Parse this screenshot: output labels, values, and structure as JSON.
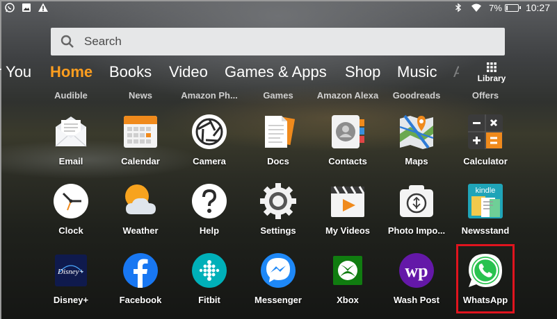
{
  "status_bar": {
    "battery": "7%",
    "time": "10:27",
    "left_icons": [
      "whatsapp-notification-icon",
      "image-notification-icon",
      "warning-icon"
    ],
    "right_icons": [
      "bluetooth-icon",
      "wifi-icon",
      "battery-charging-icon"
    ]
  },
  "search": {
    "placeholder": "Search"
  },
  "tabs": [
    {
      "label": "r You",
      "state": "partial"
    },
    {
      "label": "Home",
      "state": "active"
    },
    {
      "label": "Books",
      "state": "normal"
    },
    {
      "label": "Video",
      "state": "normal"
    },
    {
      "label": "Games & Apps",
      "state": "normal"
    },
    {
      "label": "Shop",
      "state": "normal"
    },
    {
      "label": "Music",
      "state": "normal"
    },
    {
      "label": "Aud",
      "state": "faded"
    }
  ],
  "library": {
    "label": "Library"
  },
  "cut_row": [
    "Audible",
    "News",
    "Amazon Ph...",
    "Games",
    "Amazon Alexa",
    "Goodreads",
    "Offers"
  ],
  "apps": [
    {
      "label": "Email",
      "icon": "email-icon"
    },
    {
      "label": "Calendar",
      "icon": "calendar-icon"
    },
    {
      "label": "Camera",
      "icon": "camera-icon"
    },
    {
      "label": "Docs",
      "icon": "docs-icon"
    },
    {
      "label": "Contacts",
      "icon": "contacts-icon"
    },
    {
      "label": "Maps",
      "icon": "maps-icon"
    },
    {
      "label": "Calculator",
      "icon": "calculator-icon"
    },
    {
      "label": "Clock",
      "icon": "clock-icon"
    },
    {
      "label": "Weather",
      "icon": "weather-icon"
    },
    {
      "label": "Help",
      "icon": "help-icon"
    },
    {
      "label": "Settings",
      "icon": "settings-icon"
    },
    {
      "label": "My Videos",
      "icon": "my-videos-icon"
    },
    {
      "label": "Photo Impo...",
      "icon": "photo-import-icon"
    },
    {
      "label": "Newsstand",
      "icon": "newsstand-icon"
    },
    {
      "label": "Disney+",
      "icon": "disney-plus-icon"
    },
    {
      "label": "Facebook",
      "icon": "facebook-icon"
    },
    {
      "label": "Fitbit",
      "icon": "fitbit-icon"
    },
    {
      "label": "Messenger",
      "icon": "messenger-icon"
    },
    {
      "label": "Xbox",
      "icon": "xbox-icon"
    },
    {
      "label": "Wash Post",
      "icon": "wash-post-icon"
    },
    {
      "label": "WhatsApp",
      "icon": "whatsapp-icon",
      "highlighted": true
    }
  ],
  "icon_text": {
    "disney": "Disney+",
    "kindle": "kindle",
    "wp": "wp"
  },
  "colors": {
    "active_tab": "#ff9e1f",
    "highlight": "#e0141e"
  }
}
